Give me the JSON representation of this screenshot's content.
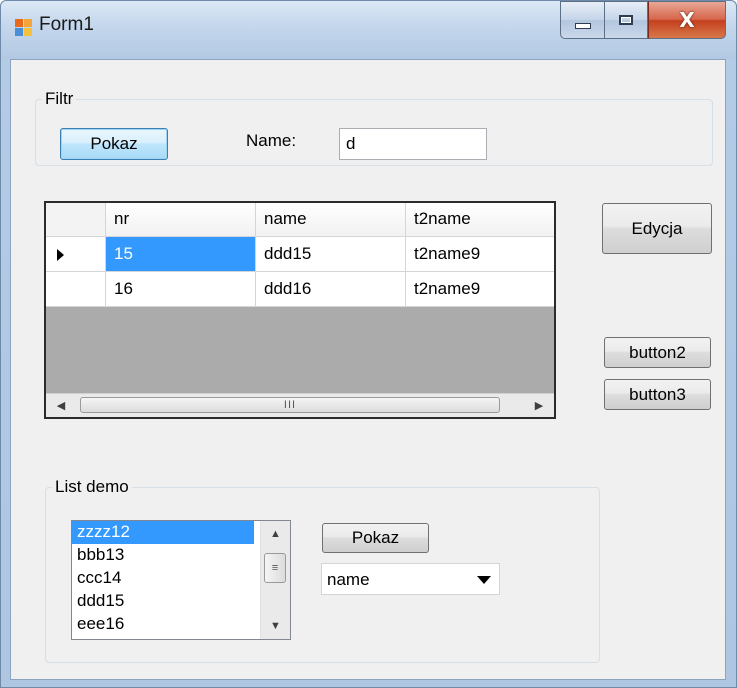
{
  "window": {
    "title": "Form1",
    "close_glyph": "X"
  },
  "filter": {
    "group_label": "Filtr",
    "show_button": "Pokaz",
    "name_label": "Name:",
    "name_value": "d"
  },
  "grid": {
    "columns": [
      "nr",
      "name",
      "t2name"
    ],
    "rows": [
      {
        "nr": "15",
        "name": "ddd15",
        "t2name": "t2name9"
      },
      {
        "nr": "16",
        "name": "ddd16",
        "t2name": "t2name9"
      }
    ],
    "selected_row": 0,
    "scroll_thumb_grip": "III"
  },
  "side_buttons": {
    "edit": "Edycja",
    "button2": "button2",
    "button3": "button3"
  },
  "list_demo": {
    "group_label": "List demo",
    "items": [
      "zzzz12",
      "bbb13",
      "ccc14",
      "ddd15",
      "eee16"
    ],
    "selected_index": 0,
    "show_button": "Pokaz",
    "combo_value": "name"
  },
  "icons": [
    "app-icon",
    "minimize-icon",
    "maximize-icon",
    "close-icon",
    "row-pointer-icon",
    "scroll-left-icon",
    "scroll-right-icon",
    "scroll-up-icon",
    "scroll-down-icon",
    "dropdown-arrow-icon"
  ]
}
